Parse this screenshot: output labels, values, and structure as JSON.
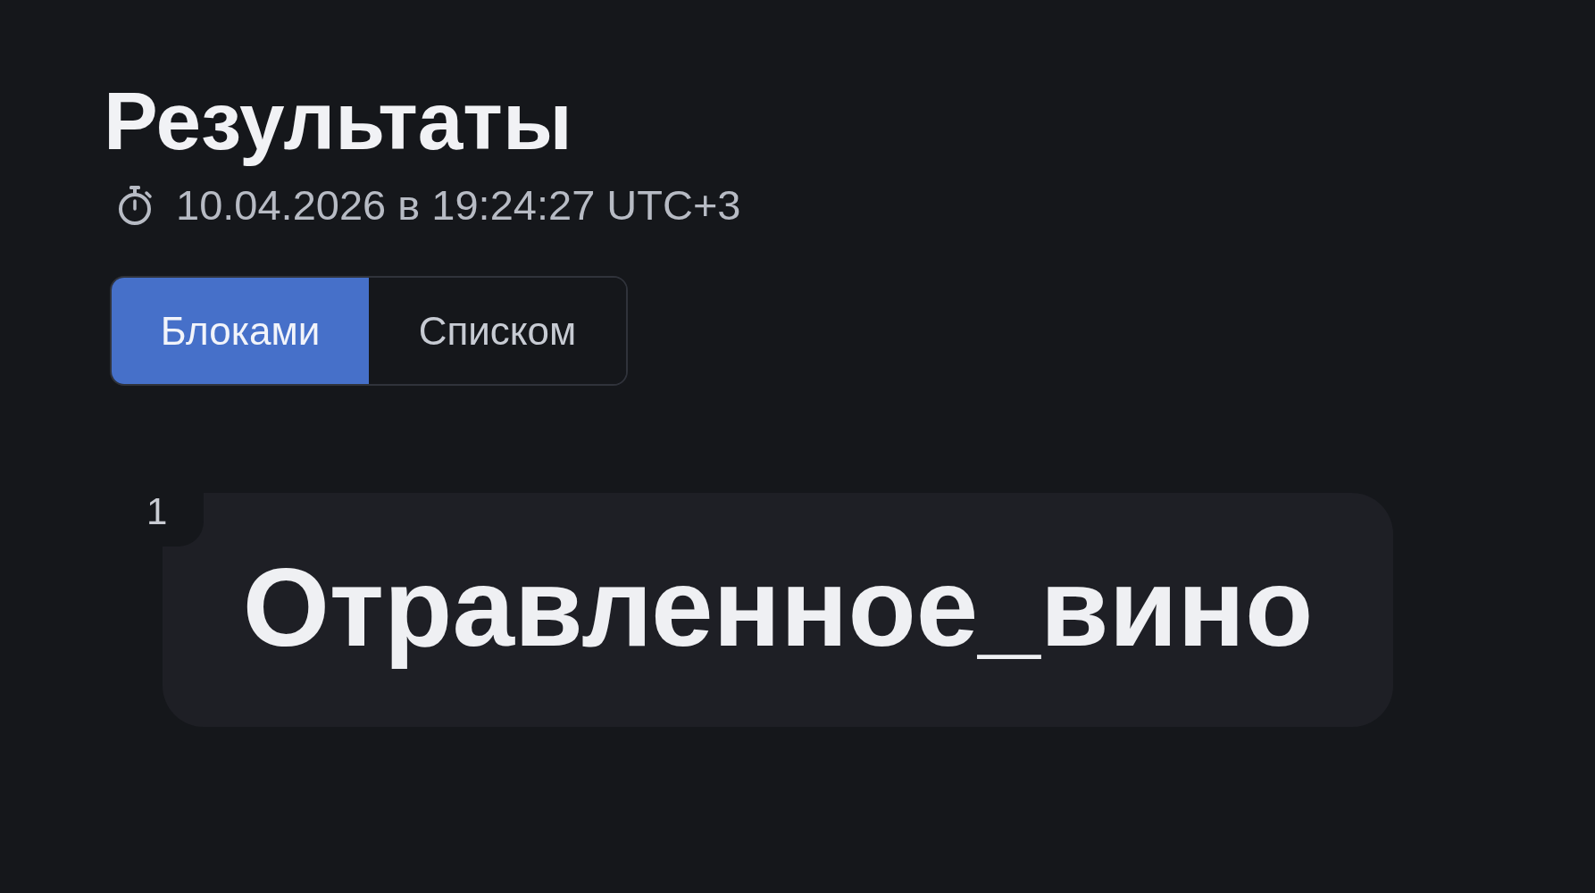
{
  "header": {
    "title": "Результаты",
    "timestamp": "10.04.2026 в 19:24:27 UTC+3"
  },
  "view_tabs": [
    {
      "label": "Блоками",
      "selected": true
    },
    {
      "label": "Списком",
      "selected": false
    }
  ],
  "results": [
    {
      "number": "1",
      "text": "Отравленное_вино"
    }
  ]
}
